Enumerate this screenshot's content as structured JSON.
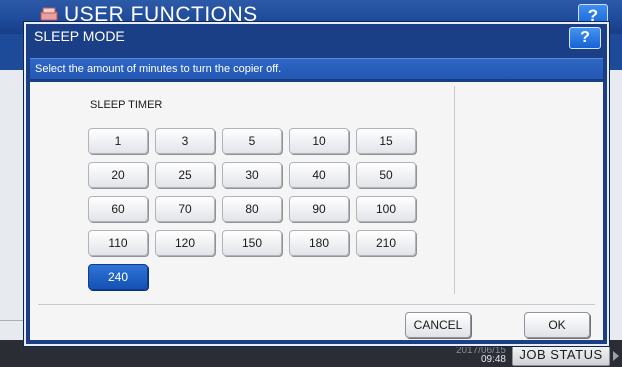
{
  "background": {
    "title": "USER FUNCTIONS",
    "help_label": "?",
    "time_top": "2017/06/15",
    "time": "09:48",
    "job_status_label": "JOB STATUS"
  },
  "dialog": {
    "title": "SLEEP MODE",
    "help_label": "?",
    "instruction": "Select the amount of minutes to turn the copier off.",
    "timer_label": "SLEEP TIMER",
    "timers": [
      {
        "label": "1"
      },
      {
        "label": "3"
      },
      {
        "label": "5"
      },
      {
        "label": "10"
      },
      {
        "label": "15"
      },
      {
        "label": "20"
      },
      {
        "label": "25"
      },
      {
        "label": "30"
      },
      {
        "label": "40"
      },
      {
        "label": "50"
      },
      {
        "label": "60"
      },
      {
        "label": "70"
      },
      {
        "label": "80"
      },
      {
        "label": "90"
      },
      {
        "label": "100"
      },
      {
        "label": "110"
      },
      {
        "label": "120"
      },
      {
        "label": "150"
      },
      {
        "label": "180"
      },
      {
        "label": "210"
      },
      {
        "label": "240"
      }
    ],
    "selected_timer": "240",
    "cancel_label": "CANCEL",
    "ok_label": "OK"
  },
  "colors": {
    "title_bar": "#1e4a9a",
    "selected": "#1f64c8"
  }
}
